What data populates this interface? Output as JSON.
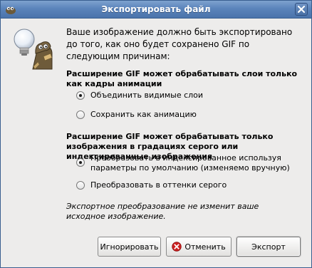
{
  "window": {
    "title": "Экспортировать файл",
    "app_icon": "gimp-icon",
    "close_icon": "close-icon"
  },
  "dialog": {
    "icon": "gimp-export-lightbulb-icon",
    "intro": "Ваше изображение должно быть экспортировано до того, как оно будет сохранено GIF по следующим причинам:",
    "sections": [
      {
        "heading": "Расширение GIF может обрабатывать слои только как кадры анимации",
        "options": [
          {
            "label": "Объединить видимые слои",
            "checked": true
          },
          {
            "label": "Сохранить как анимацию",
            "checked": false
          }
        ]
      },
      {
        "heading": "Расширение GIF может обрабатывать только изображения в градациях серого или индексированные изображения",
        "options": [
          {
            "label": "Преобразовать в индексированное используя параметры по умолчанию (изменяемо вручную)",
            "checked": true
          },
          {
            "label": "Преобразовать в оттенки серого",
            "checked": false
          }
        ]
      }
    ],
    "note": "Экспортное преобразование не изменит ваше исходное изображение."
  },
  "buttons": {
    "ignore": "Игнорировать",
    "cancel": "Отменить",
    "cancel_icon": "cancel-icon",
    "export": "Экспорт"
  }
}
